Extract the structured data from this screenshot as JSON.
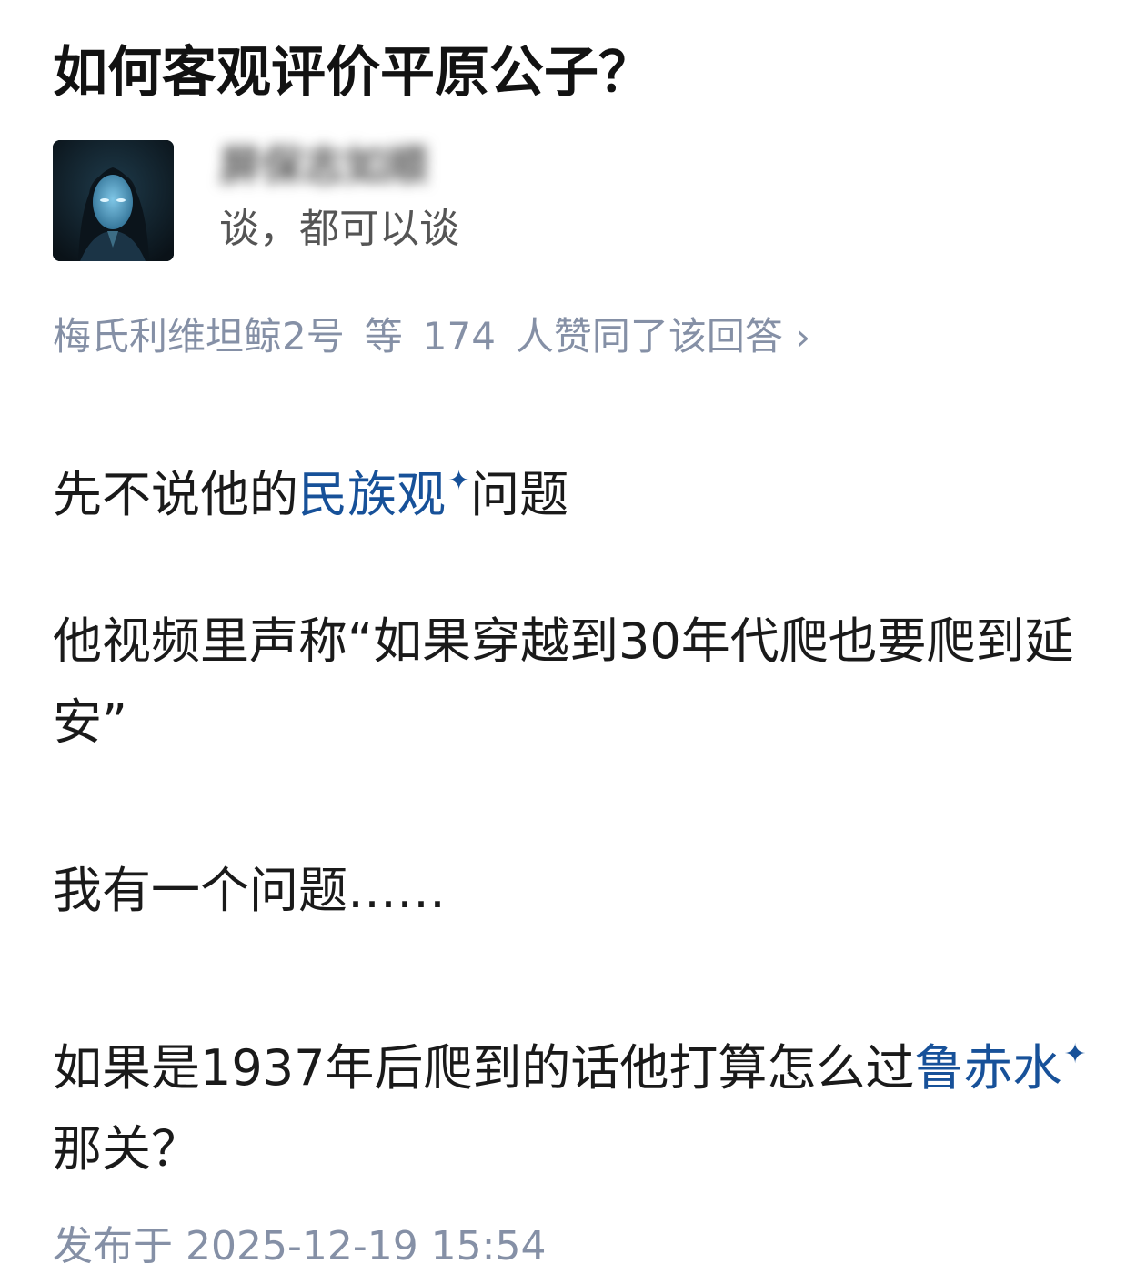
{
  "question": {
    "title": "如何客观评价平原公子？"
  },
  "author": {
    "avatar_icon": "portrait-avatar-icon",
    "name": "屏保志如顺",
    "bio": "谈，都可以谈"
  },
  "voters": {
    "name": "梅氏利维坦鲸2号",
    "etc": "等",
    "count": "174",
    "suffix": "人赞同了该回答",
    "chevron": "›"
  },
  "content": {
    "p1": {
      "before": "先不说他的",
      "link": "民族观",
      "after": "问题"
    },
    "p2": "他视频里声称“如果穿越到30年代爬也要爬到延安”",
    "p3": "我有一个问题……",
    "p4": {
      "before": "如果是1937年后爬到的话他打算怎么过",
      "link": "鲁赤水",
      "after": "那关？"
    },
    "spark_glyph": "✦"
  },
  "footer": {
    "published": "发布于 2025-12-19 15:54"
  },
  "colors": {
    "link": "#175199",
    "meta": "#8590a6",
    "text": "#1a1a1a"
  }
}
